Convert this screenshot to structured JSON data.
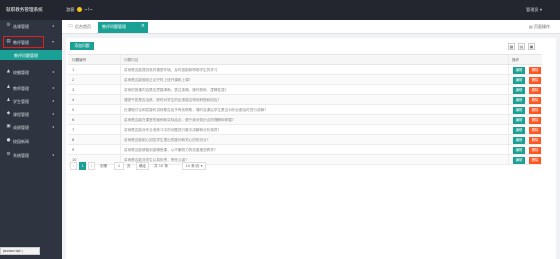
{
  "header": {
    "brand": "就职教务管理系统",
    "greeting_prefix": "游客",
    "greeting_suffix": "~!~",
    "user_menu": "管理员 ▾"
  },
  "sidebar": {
    "items": [
      {
        "label": "选课管理",
        "icon": "select-icon",
        "glyph": "☰"
      },
      {
        "label": "教评管理",
        "icon": "list-icon",
        "glyph": "▤"
      },
      {
        "label": "教评问题管理",
        "icon": "",
        "glyph": ""
      },
      {
        "label": "校徽管理",
        "icon": "badge-icon",
        "glyph": "▲"
      },
      {
        "label": "教师管理",
        "icon": "teacher-icon",
        "glyph": "♟"
      },
      {
        "label": "学生管理",
        "icon": "student-icon",
        "glyph": "♟"
      },
      {
        "label": "课程管理",
        "icon": "course-icon",
        "glyph": "◆"
      },
      {
        "label": "成绩管理",
        "icon": "grade-icon",
        "glyph": "▣"
      },
      {
        "label": "校园新闻",
        "icon": "news-icon",
        "glyph": "●"
      },
      {
        "label": "系统管理",
        "icon": "system-icon",
        "glyph": "⚙"
      }
    ],
    "status_text": "javascript:;"
  },
  "tabs": {
    "home": "后台首页",
    "active": "教评问题管理",
    "ops": "页面操作"
  },
  "toolbar": {
    "add_label": "添加问题"
  },
  "table": {
    "headers": {
      "id": "问题编号",
      "question": "问题内容",
      "ops": "操作"
    },
    "edit_label": "编辑",
    "delete_label": "删除",
    "rows": [
      {
        "id": "1",
        "question": "讲师是否能提供良好课堂环境，及时激励和帮助学生的学习"
      },
      {
        "id": "2",
        "question": "讲师是否能做到正点守时上班开课和上课?"
      },
      {
        "id": "3",
        "question": "讲师的授课内容是否思路清晰、表达准确、操作熟练、逻辑性强?"
      },
      {
        "id": "4",
        "question": "课堂气氛是否活跃，即时对学生的反馈能否得到积极和回应?"
      },
      {
        "id": "5",
        "question": "在课程讨论和答疑时讲师是否给予有效帮助，课时及课后学生是否对作业都及时进行讲解?"
      },
      {
        "id": "6",
        "question": "讲师是否能在课堂的案例和实际结合，便于我对知识点的理解和掌握?"
      },
      {
        "id": "7",
        "question": "讲师是否能对作业或练习中的问题进行集中讲解和分析指导?"
      },
      {
        "id": "8",
        "question": "讲师是否能耐心回答学生提出的疑问和关心的知识点?"
      },
      {
        "id": "9",
        "question": "讲师是否能够做到激情授课，以不懈努力的态度推进教学?"
      },
      {
        "id": "10",
        "question": "讲师是否能对学生认真负责，责任心强?"
      }
    ]
  },
  "pagination": {
    "prev": "‹",
    "current": "1",
    "next": "›",
    "goto_label": "到第",
    "goto_value": "1",
    "page_label": "页",
    "confirm_label": "确定",
    "total": "共 10 条",
    "per_page": "10 条/页 ▾"
  },
  "colors": {
    "accent": "#1aa094",
    "danger": "#ff5722",
    "header_bg": "#23262e",
    "sidebar_bg": "#2f3540"
  }
}
